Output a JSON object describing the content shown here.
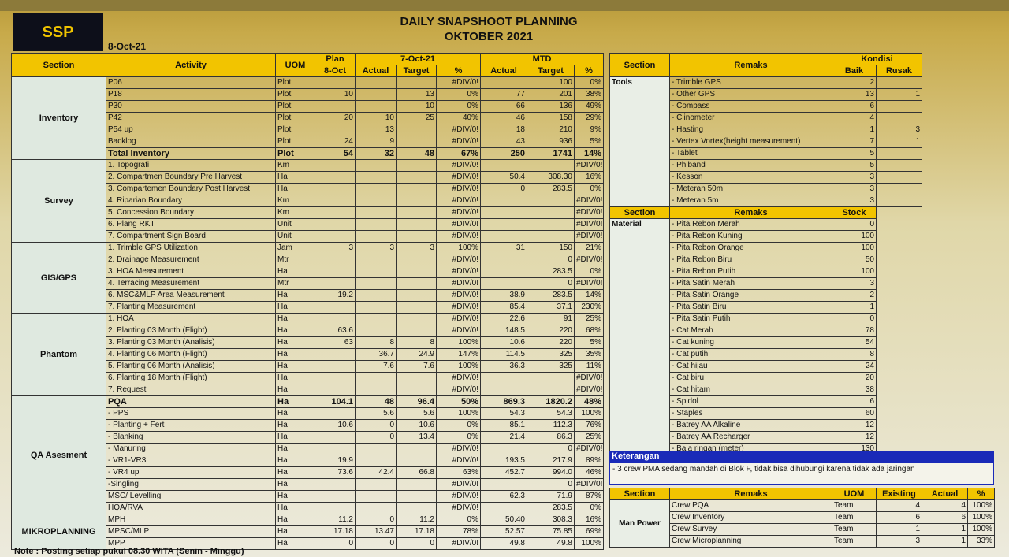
{
  "header": {
    "logo": "SSP",
    "date": "8-Oct-21",
    "title_line1": "DAILY SNAPSHOOT PLANNING",
    "title_line2": "OKTOBER 2021"
  },
  "left_headers": {
    "section": "Section",
    "activity": "Activity",
    "uom": "UOM",
    "plan": "Plan",
    "plan_date": "8-Oct",
    "day": "7-Oct-21",
    "mtd": "MTD",
    "actual": "Actual",
    "target": "Target",
    "pct": "%"
  },
  "sections": [
    {
      "name": "Inventory",
      "rows": [
        [
          "P06",
          "Plot",
          "",
          "",
          "",
          "#DIV/0!",
          "",
          "100",
          "0%"
        ],
        [
          "P18",
          "Plot",
          "10",
          "",
          "13",
          "0%",
          "77",
          "201",
          "38%"
        ],
        [
          "P30",
          "Plot",
          "",
          "",
          "10",
          "0%",
          "66",
          "136",
          "49%"
        ],
        [
          "P42",
          "Plot",
          "20",
          "10",
          "25",
          "40%",
          "46",
          "158",
          "29%"
        ],
        [
          "P54 up",
          "Plot",
          "",
          "13",
          "",
          "#DIV/0!",
          "18",
          "210",
          "9%"
        ],
        [
          "Backlog",
          "Plot",
          "24",
          "9",
          "",
          "#DIV/0!",
          "43",
          "936",
          "5%"
        ],
        [
          "Total Inventory",
          "Plot",
          "54",
          "32",
          "48",
          "67%",
          "250",
          "1741",
          "14%"
        ]
      ]
    },
    {
      "name": "Survey",
      "rows": [
        [
          "1. Topografi",
          "Km",
          "",
          "",
          "",
          "#DIV/0!",
          "",
          "",
          "#DIV/0!"
        ],
        [
          "2. Compartmen Boundary Pre Harvest",
          "Ha",
          "",
          "",
          "",
          "#DIV/0!",
          "50.4",
          "308.30",
          "16%"
        ],
        [
          "3. Compartemen Boundary Post Harvest",
          "Ha",
          "",
          "",
          "",
          "#DIV/0!",
          "0",
          "283.5",
          "0%"
        ],
        [
          "4. Riparian Boundary",
          "Km",
          "",
          "",
          "",
          "#DIV/0!",
          "",
          "",
          "#DIV/0!"
        ],
        [
          "5. Concession Boundary",
          "Km",
          "",
          "",
          "",
          "#DIV/0!",
          "",
          "",
          "#DIV/0!"
        ],
        [
          "6. Plang RKT",
          "Unit",
          "",
          "",
          "",
          "#DIV/0!",
          "",
          "",
          "#DIV/0!"
        ],
        [
          "7. Compartment Sign Board",
          "Unit",
          "",
          "",
          "",
          "#DIV/0!",
          "",
          "",
          "#DIV/0!"
        ]
      ]
    },
    {
      "name": "GIS/GPS",
      "rows": [
        [
          "1. Trimble GPS Utilization",
          "Jam",
          "3",
          "3",
          "3",
          "100%",
          "31",
          "150",
          "21%"
        ],
        [
          "2. Drainage Measurement",
          "Mtr",
          "",
          "",
          "",
          "#DIV/0!",
          "",
          "0",
          "#DIV/0!"
        ],
        [
          "3. HOA Measurement",
          "Ha",
          "",
          "",
          "",
          "#DIV/0!",
          "",
          "283.5",
          "0%"
        ],
        [
          "4. Terracing Measurement",
          "Mtr",
          "",
          "",
          "",
          "#DIV/0!",
          "",
          "0",
          "#DIV/0!"
        ],
        [
          "6. MSC&MLP Area Measurement",
          "Ha",
          "19.2",
          "",
          "",
          "#DIV/0!",
          "38.9",
          "283.5",
          "14%"
        ],
        [
          "7. Planting Measurement",
          "Ha",
          "",
          "",
          "",
          "#DIV/0!",
          "85.4",
          "37.1",
          "230%"
        ]
      ]
    },
    {
      "name": "Phantom",
      "rows": [
        [
          "1. HOA",
          "Ha",
          "",
          "",
          "",
          "#DIV/0!",
          "22.6",
          "91",
          "25%"
        ],
        [
          "2. Planting 03 Month (Flight)",
          "Ha",
          "63.6",
          "",
          "",
          "#DIV/0!",
          "148.5",
          "220",
          "68%"
        ],
        [
          "3. Planting 03 Month (Analisis)",
          "Ha",
          "63",
          "8",
          "8",
          "100%",
          "10.6",
          "220",
          "5%"
        ],
        [
          "4. Planting 06 Month (Flight)",
          "Ha",
          "",
          "36.7",
          "24.9",
          "147%",
          "114.5",
          "325",
          "35%"
        ],
        [
          "5. Planting 06 Month (Analisis)",
          "Ha",
          "",
          "7.6",
          "7.6",
          "100%",
          "36.3",
          "325",
          "11%"
        ],
        [
          "6. Planting 18 Month (Flight)",
          "Ha",
          "",
          "",
          "",
          "#DIV/0!",
          "",
          "",
          "#DIV/0!"
        ],
        [
          "7. Request",
          "Ha",
          "",
          "",
          "",
          "#DIV/0!",
          "",
          "",
          "#DIV/0!"
        ]
      ]
    },
    {
      "name": "QA Asesment",
      "rows": [
        [
          "PQA",
          "Ha",
          "104.1",
          "48",
          "96.4",
          "50%",
          "869.3",
          "1820.2",
          "48%"
        ],
        [
          "- PPS",
          "Ha",
          "",
          "5.6",
          "5.6",
          "100%",
          "54.3",
          "54.3",
          "100%"
        ],
        [
          "- Planting + Fert",
          "Ha",
          "10.6",
          "0",
          "10.6",
          "0%",
          "85.1",
          "112.3",
          "76%"
        ],
        [
          "- Blanking",
          "Ha",
          "",
          "0",
          "13.4",
          "0%",
          "21.4",
          "86.3",
          "25%"
        ],
        [
          "- Manuring",
          "Ha",
          "",
          "",
          "",
          "#DIV/0!",
          "",
          "0",
          "#DIV/0!"
        ],
        [
          "- VR1-VR3",
          "Ha",
          "19.9",
          "",
          "",
          "#DIV/0!",
          "193.5",
          "217.9",
          "89%"
        ],
        [
          "- VR4 up",
          "Ha",
          "73.6",
          "42.4",
          "66.8",
          "63%",
          "452.7",
          "994.0",
          "46%"
        ],
        [
          "-Singling",
          "Ha",
          "",
          "",
          "",
          "#DIV/0!",
          "",
          "0",
          "#DIV/0!"
        ],
        [
          "MSC/ Levelling",
          "Ha",
          "",
          "",
          "",
          "#DIV/0!",
          "62.3",
          "71.9",
          "87%"
        ],
        [
          "HQA/RVA",
          "Ha",
          "",
          "",
          "",
          "#DIV/0!",
          "",
          "283.5",
          "0%"
        ]
      ]
    },
    {
      "name": "MIKROPLANNING",
      "rows": [
        [
          "MPH",
          "Ha",
          "11.2",
          "0",
          "11.2",
          "0%",
          "50.40",
          "308.3",
          "16%"
        ],
        [
          "MPSC/MLP",
          "Ha",
          "17.18",
          "13.47",
          "17.18",
          "78%",
          "52.57",
          "75.85",
          "69%"
        ],
        [
          "MPP",
          "Ha",
          "0",
          "0",
          "0",
          "#DIV/0!",
          "49.8",
          "49.8",
          "100%"
        ]
      ]
    }
  ],
  "tools": {
    "section_label": "Section",
    "remaks_label": "Remaks",
    "kondisi_label": "Kondisi",
    "baik_label": "Baik",
    "rusak_label": "Rusak",
    "name": "Tools",
    "items": [
      [
        "- Trimble GPS",
        "2",
        ""
      ],
      [
        "- Other GPS",
        "13",
        "1"
      ],
      [
        "- Compass",
        "6",
        ""
      ],
      [
        "- Clinometer",
        "4",
        ""
      ],
      [
        "- Hasting",
        "1",
        "3"
      ],
      [
        "- Vertex Vortex(height measurement)",
        "7",
        "1"
      ],
      [
        "- Tablet",
        "5",
        ""
      ],
      [
        "- Phiband",
        "5",
        ""
      ],
      [
        "- Kesson",
        "3",
        ""
      ],
      [
        "- Meteran 50m",
        "3",
        ""
      ],
      [
        "- Meteran 5m",
        "3",
        ""
      ]
    ]
  },
  "material": {
    "section_label": "Section",
    "remaks_label": "Remaks",
    "stock_label": "Stock",
    "name": "Material",
    "items": [
      [
        "- Pita Rebon Merah",
        "0"
      ],
      [
        "- Pita Rebon Kuning",
        "100"
      ],
      [
        "- Pita Rebon Orange",
        "100"
      ],
      [
        "- Pita Rebon Biru",
        "50"
      ],
      [
        "- Pita Rebon Putih",
        "100"
      ],
      [
        "- Pita Satin Merah",
        "3"
      ],
      [
        "- Pita Satin Orange",
        "2"
      ],
      [
        "- Pita Satin Biru",
        "1"
      ],
      [
        "- Pita Satin Putih",
        "0"
      ],
      [
        "- Cat Merah",
        "78"
      ],
      [
        "- Cat kuning",
        "54"
      ],
      [
        "- Cat putih",
        "8"
      ],
      [
        "- Cat hijau",
        "24"
      ],
      [
        "- Cat biru",
        "20"
      ],
      [
        "- Cat hitam",
        "38"
      ],
      [
        "- Spidol",
        "6"
      ],
      [
        "- Staples",
        "60"
      ],
      [
        "- Batrey AA Alkaline",
        "12"
      ],
      [
        "- Batrey AA Recharger",
        "12"
      ],
      [
        "- Baja ringan (meter)",
        "130"
      ]
    ]
  },
  "keterangan": {
    "title": "Keterangan",
    "text": "- 3 crew PMA sedang mandah di Blok F, tidak bisa dihubungi karena tidak ada jaringan"
  },
  "manpower": {
    "section_label": "Section",
    "remaks_label": "Remaks",
    "uom_label": "UOM",
    "existing_label": "Existing",
    "actual_label": "Actual",
    "pct_label": "%",
    "name": "Man Power",
    "items": [
      [
        "Crew PQA",
        "Team",
        "4",
        "4",
        "100%"
      ],
      [
        "Crew Inventory",
        "Team",
        "6",
        "6",
        "100%"
      ],
      [
        "Crew Survey",
        "Team",
        "1",
        "1",
        "100%"
      ],
      [
        "Crew Microplanning",
        "Team",
        "3",
        "1",
        "33%"
      ]
    ]
  },
  "note": "Note : Posting setiap pukul 08.30 WITA (Senin - Minggu)"
}
